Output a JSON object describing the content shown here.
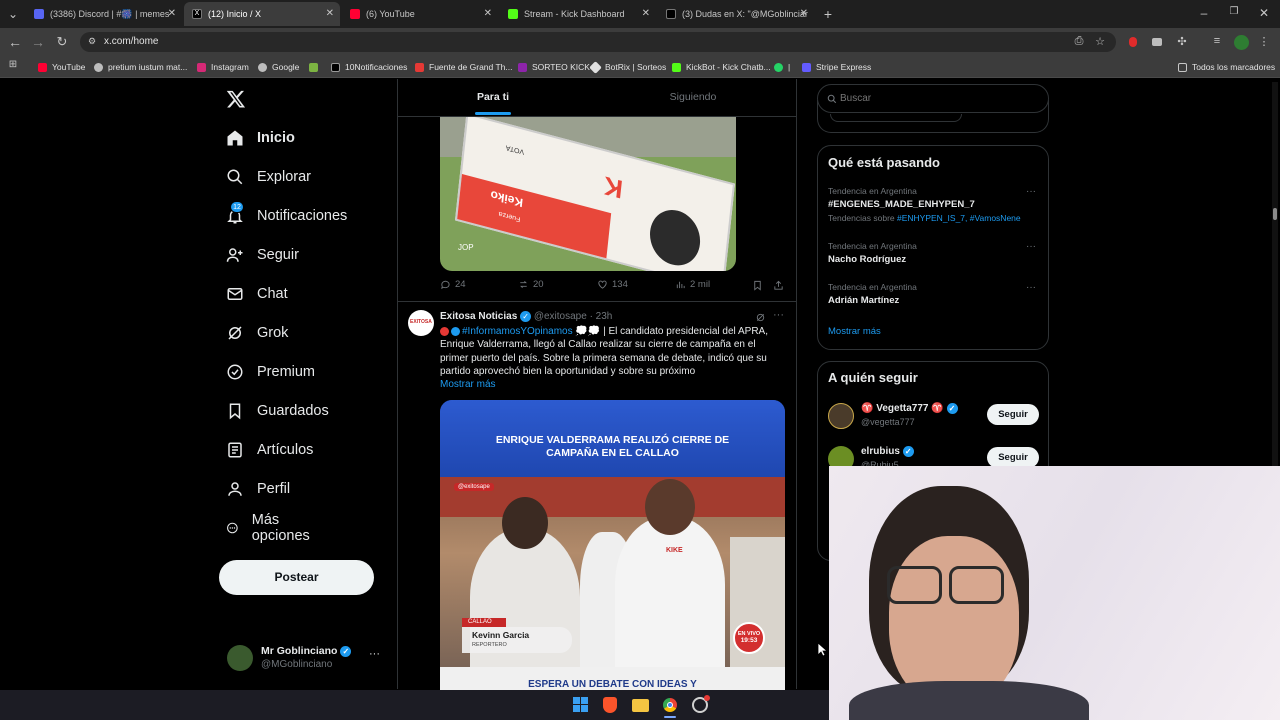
{
  "browser": {
    "tabs": [
      {
        "label": "(3386) Discord | #🎆 | memes"
      },
      {
        "label": "(12) Inicio / X"
      },
      {
        "label": "(6) YouTube"
      },
      {
        "label": "Stream - Kick Dashboard"
      },
      {
        "label": "(3) Dudas en X: \"@MGoblinciar"
      }
    ],
    "url": "x.com/home",
    "bookmarks": [
      {
        "label": "YouTube"
      },
      {
        "label": "pretium iustum mat..."
      },
      {
        "label": "Instagram"
      },
      {
        "label": "Google"
      },
      {
        "label": "10Notificaciones"
      },
      {
        "label": "Fuente de Grand Th..."
      },
      {
        "label": "SORTEO KICK"
      },
      {
        "label": "BotRix | Sorteos"
      },
      {
        "label": "KickBot - Kick Chatb..."
      },
      {
        "label": "|"
      },
      {
        "label": "Stripe Express"
      },
      {
        "label": "Todos los marcadores"
      }
    ]
  },
  "sidebar": {
    "items": [
      {
        "label": "Inicio",
        "icon": "home-icon"
      },
      {
        "label": "Explorar",
        "icon": "search-icon"
      },
      {
        "label": "Notificaciones",
        "icon": "bell-icon",
        "badge": "12"
      },
      {
        "label": "Seguir",
        "icon": "add-user-icon"
      },
      {
        "label": "Chat",
        "icon": "mail-icon"
      },
      {
        "label": "Grok",
        "icon": "grok-icon"
      },
      {
        "label": "Premium",
        "icon": "premium-icon"
      },
      {
        "label": "Guardados",
        "icon": "bookmark-icon"
      },
      {
        "label": "Artículos",
        "icon": "articles-icon"
      },
      {
        "label": "Perfil",
        "icon": "person-icon"
      },
      {
        "label": "Más opciones",
        "icon": "more-circle-icon"
      }
    ],
    "post_button": "Postear",
    "account": {
      "name": "Mr Goblinciano",
      "handle": "@MGoblinciano",
      "more": "···"
    }
  },
  "feed": {
    "tabs": [
      "Para ti",
      "Siguiendo"
    ],
    "first_post": {
      "image_credit": "JOP",
      "image_text": [
        "VOTA",
        "K",
        "Keiko",
        "Fuerza"
      ],
      "replies": "24",
      "reposts": "20",
      "likes": "134",
      "views": "2 mil"
    },
    "post": {
      "author": "Exitosa Noticias",
      "handle": "@exitosape",
      "time": "· 23h",
      "avatar_text": "EXITOSA",
      "text_hashtag": "#InformamosYOpinamos",
      "text": "💭💭 | El candidato presidencial del APRA, Enrique Valderrama, llegó al Callao realizar su cierre de campaña en el primer puerto del país. Sobre la primera semana de debate, indicó que su partido aprovechó bien la oportunidad y sobre su próximo",
      "show_more": "Mostrar más",
      "more": "···",
      "media": {
        "headline": "ENRIQUE VALDERRAMA REALIZÓ CIERRE DE CAMPAÑA EN EL CALLAO",
        "watermark": "@exitosape",
        "location": "CALLAO",
        "reporter_name": "Kevinn Garcia",
        "reporter_role": "REPORTERO",
        "live": "EN VIVO",
        "live_time": "19:53",
        "shirt_text": "KIKE",
        "bottom_text": "ESPERA UN DEBATE CON IDEAS Y"
      }
    }
  },
  "right": {
    "search_placeholder": "Buscar",
    "trends_title": "Qué está pasando",
    "trends": [
      {
        "context": "Tendencia en Argentina",
        "name": "#ENGENES_MADE_ENHYPEN_7",
        "sub_prefix": "Tendencias sobre ",
        "sub": "#ENHYPEN_IS_7, #VamosNene"
      },
      {
        "context": "Tendencia en Argentina",
        "name": "Nacho Rodríguez"
      },
      {
        "context": "Tendencia en Argentina",
        "name": "Adrián Martínez"
      }
    ],
    "show_more": "Mostrar más",
    "who_title": "A quién seguir",
    "follow": [
      {
        "name": "♈ Vegetta777 ♈",
        "handle": "@vegetta777",
        "button": "Seguir"
      },
      {
        "name": "elrubius",
        "handle": "@Rubiu5",
        "button": "Seguir"
      }
    ]
  },
  "colors": {
    "accent": "#1d9bf0",
    "chrome_dark": "#1f1f1f",
    "chrome_mid": "#3c3c3c"
  }
}
